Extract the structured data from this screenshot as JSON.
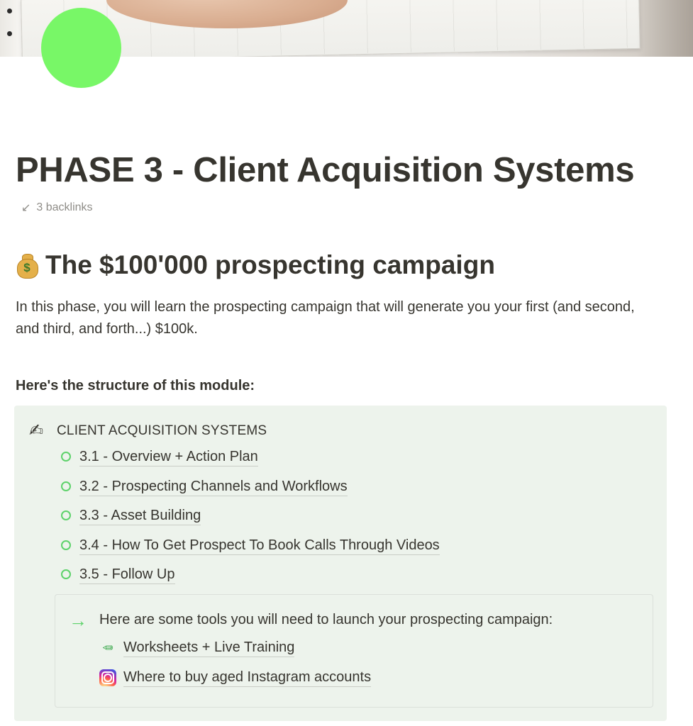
{
  "page": {
    "title": "PHASE 3 - Client Acquisition Systems",
    "backlinks": "3 backlinks",
    "backlinks_icon": "arrow-down-left-icon",
    "icon_color": "#78f767"
  },
  "section": {
    "heading": "The $100'000 prospecting campaign",
    "heading_icon": "money-bag-icon",
    "intro": "In this phase, you will learn the prospecting campaign that will generate you your first (and second, and third, and forth...) $100k.",
    "structure_label": "Here's the structure of this module:"
  },
  "callout": {
    "icon": "writing-hand-icon",
    "title": "CLIENT ACQUISITION SYSTEMS",
    "background": "#edf3ec",
    "items": [
      {
        "label": "3.1 - Overview + Action Plan"
      },
      {
        "label": "3.2 - Prospecting Channels and Workflows"
      },
      {
        "label": "3.3 - Asset Building"
      },
      {
        "label": "3.4 - How To Get Prospect To Book Calls Through Videos"
      },
      {
        "label": "3.5 - Follow Up"
      }
    ],
    "tools": {
      "icon": "arrow-right-icon",
      "intro": "Here are some tools you will need to launch your prospecting campaign:",
      "links": [
        {
          "label": "Worksheets + Live Training",
          "icon": "pencil-icon"
        },
        {
          "label": "Where to buy aged Instagram accounts",
          "icon": "instagram-icon"
        }
      ]
    }
  }
}
